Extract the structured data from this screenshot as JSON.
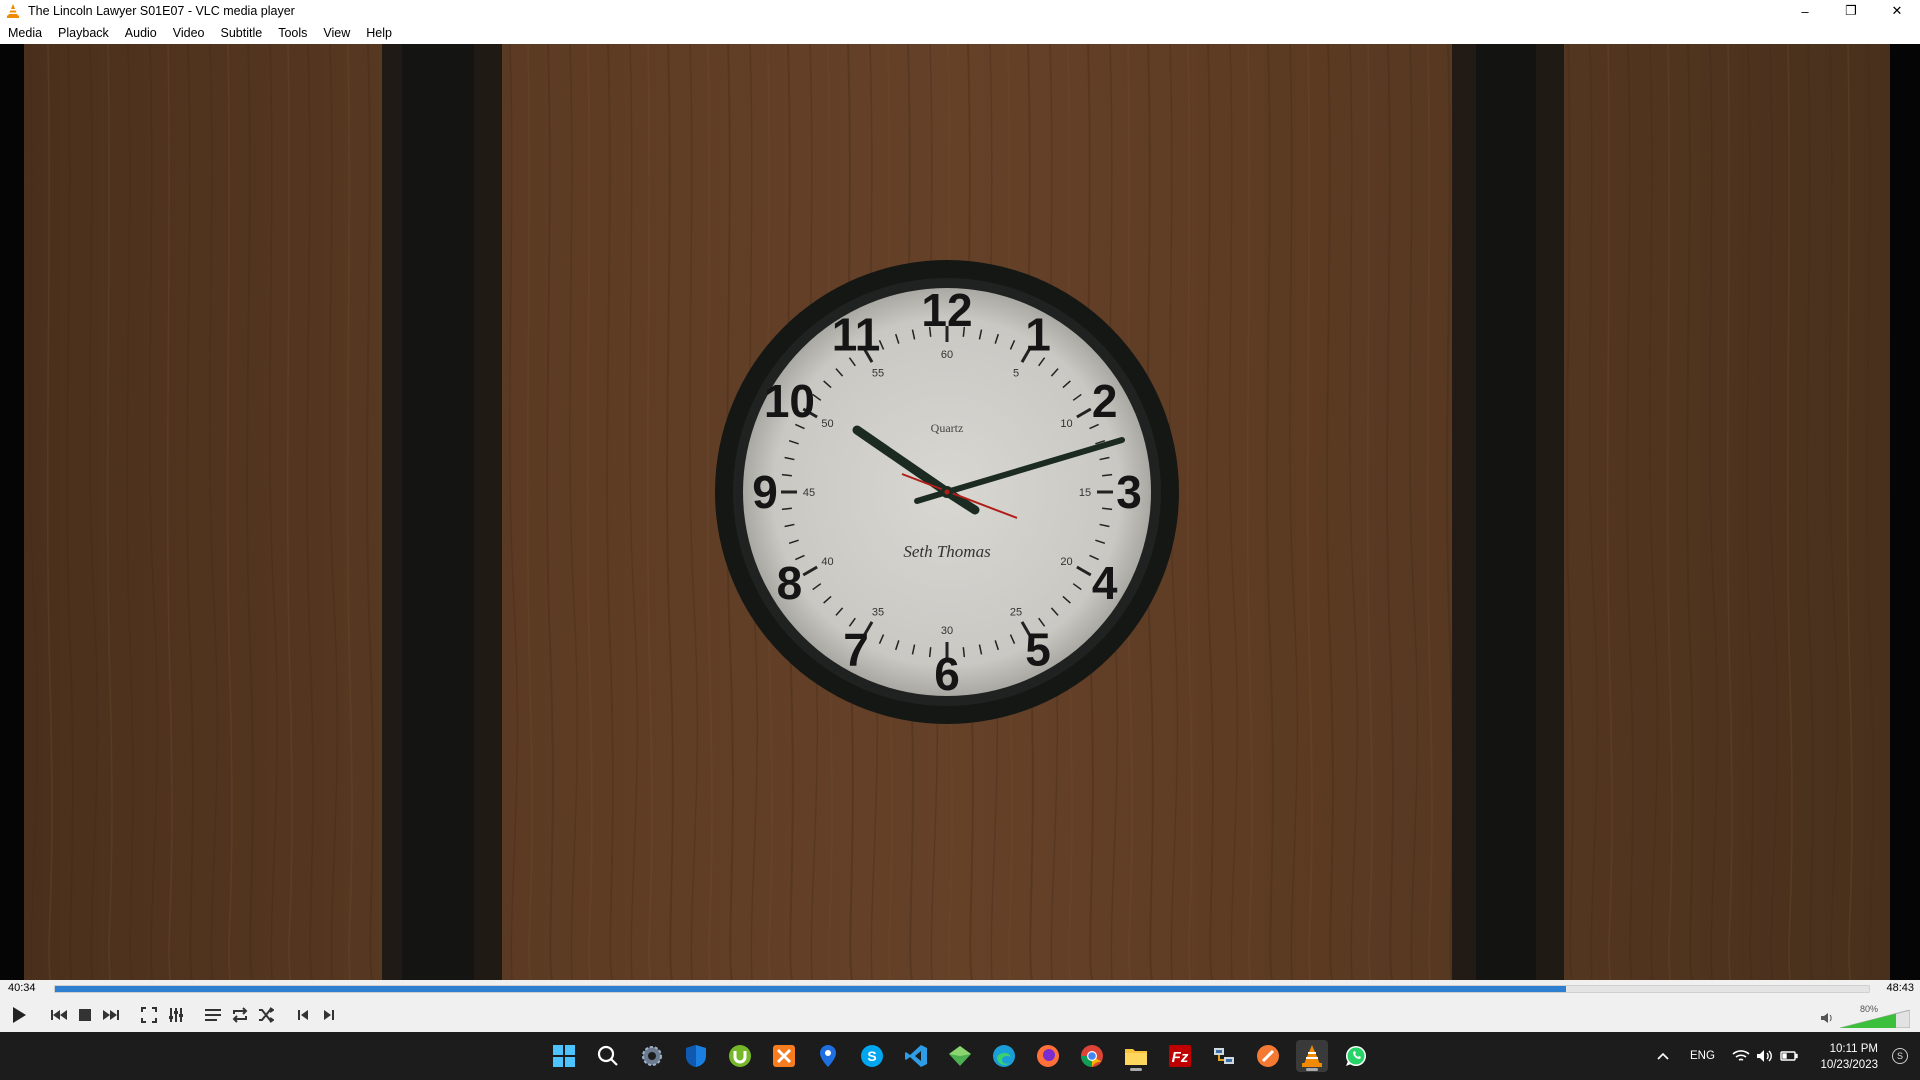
{
  "window": {
    "title": "The Lincoln Lawyer S01E07 - VLC media player",
    "controls": {
      "minimize": "–",
      "restore": "❐",
      "close": "✕"
    }
  },
  "menu": [
    "Media",
    "Playback",
    "Audio",
    "Video",
    "Subtitle",
    "Tools",
    "View",
    "Help"
  ],
  "clock_face": {
    "numbers": [
      "12",
      "1",
      "2",
      "3",
      "4",
      "5",
      "6",
      "7",
      "8",
      "9",
      "10",
      "11"
    ],
    "minute_labels": [
      "60",
      "5",
      "10",
      "15",
      "20",
      "25",
      "30",
      "35",
      "40",
      "45",
      "50",
      "55"
    ],
    "brand_top": "Quartz",
    "brand_script": "Seth Thomas"
  },
  "player": {
    "elapsed": "40:34",
    "total": "48:43",
    "progress": 0.833,
    "volume_label": "80%",
    "volume": 0.8
  },
  "controls": [
    "play-icon",
    "previous-icon",
    "stop-icon",
    "next-icon",
    "fullscreen-icon",
    "extended-settings-icon",
    "playlist-icon",
    "loop-icon",
    "shuffle-icon",
    "frame-back-icon",
    "frame-next-icon"
  ],
  "taskbar": {
    "apps": [
      "windows-start-icon",
      "search-icon",
      "settings-icon",
      "defender-icon",
      "utorrent-icon",
      "xampp-icon",
      "maps-icon",
      "skype-icon",
      "vscode-icon",
      "gem-icon",
      "edge-icon",
      "firefox-icon",
      "chrome-icon",
      "file-explorer-icon",
      "filezilla-icon",
      "network-icon",
      "sublime-icon",
      "vlc-icon",
      "whatsapp-icon"
    ],
    "tray": {
      "language": "ENG",
      "time": "10:11 PM",
      "date": "10/23/2023"
    }
  },
  "colors": {
    "seek_fill": "#2f7fd0",
    "wood": "#5a3a22",
    "taskbar": "#1c1c1c"
  }
}
